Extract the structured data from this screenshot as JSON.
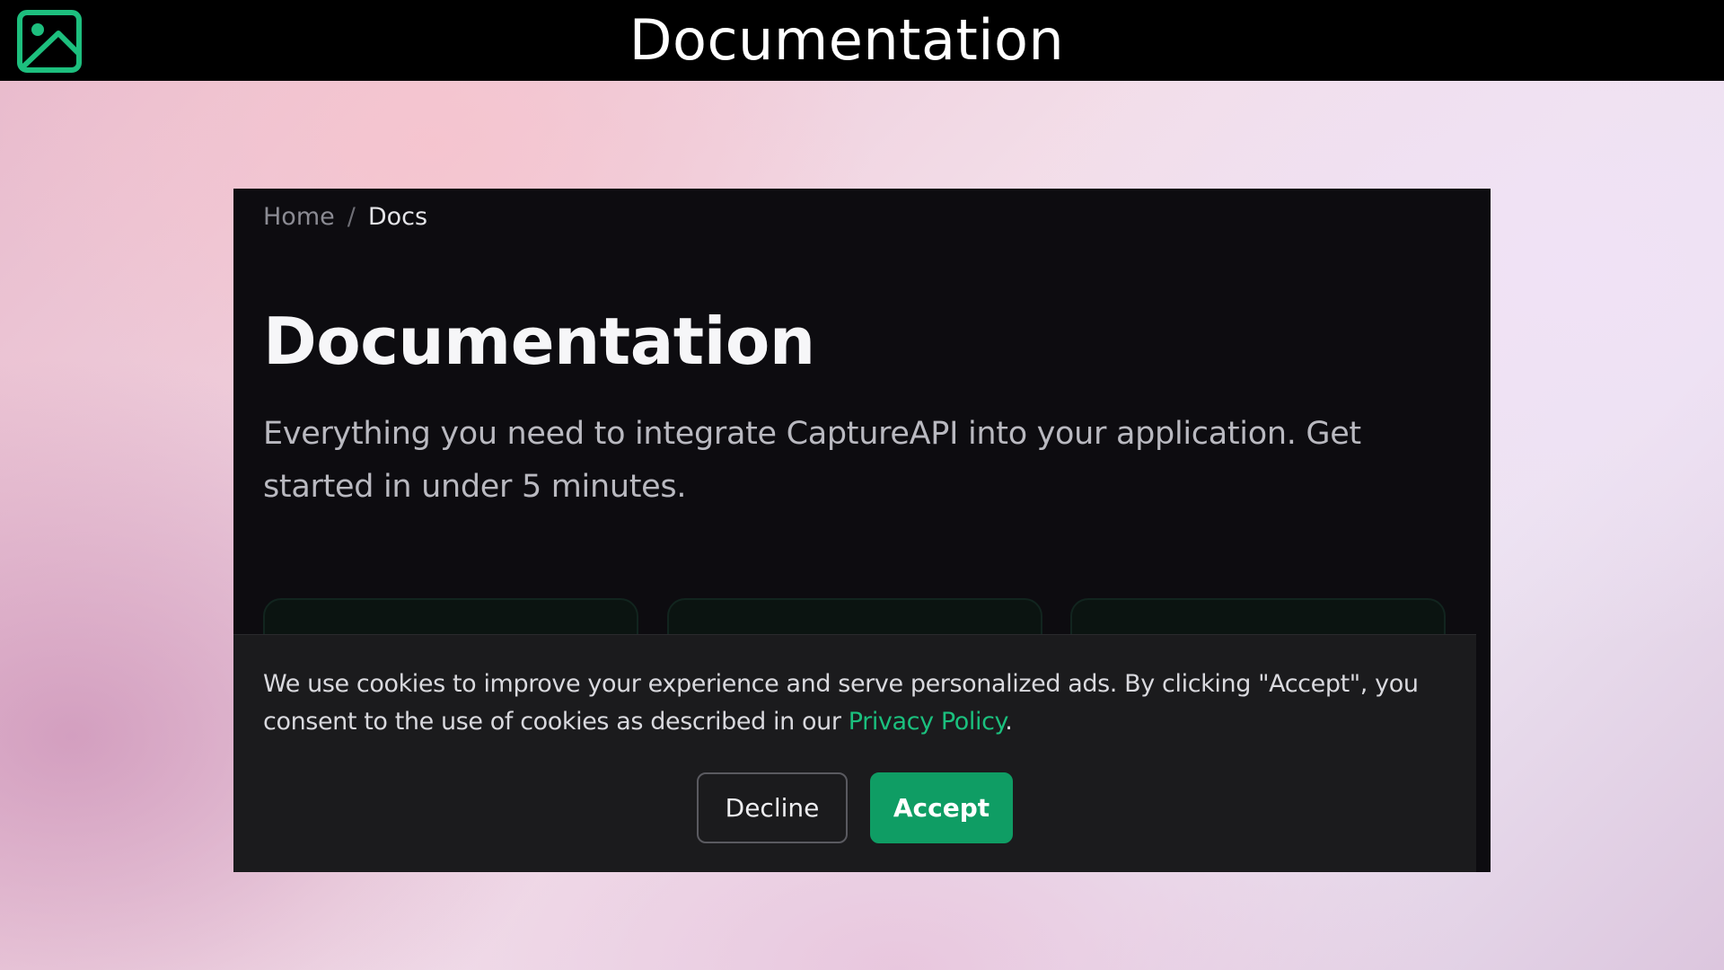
{
  "header": {
    "title": "Documentation",
    "icon": "image-icon",
    "icon_color": "#1dbf7e"
  },
  "page": {
    "breadcrumb": {
      "home": "Home",
      "separator": "/",
      "current": "Docs"
    },
    "title": "Documentation",
    "lead": "Everything you need to integrate CaptureAPI into your application. Get started in under 5 minutes."
  },
  "cookie_banner": {
    "text_before_link": "We use cookies to improve your experience and serve personalized ads. By clicking \"Accept\", you consent to the use of cookies as described in our ",
    "link_text": "Privacy Policy",
    "text_after_link": ".",
    "decline_label": "Decline",
    "accept_label": "Accept",
    "accent_color": "#0f9d64",
    "link_color": "#1bc07e"
  },
  "colors": {
    "capture_background": "#0d0c10",
    "banner_background": "#1b1b1d",
    "topbar_background": "#000000"
  }
}
